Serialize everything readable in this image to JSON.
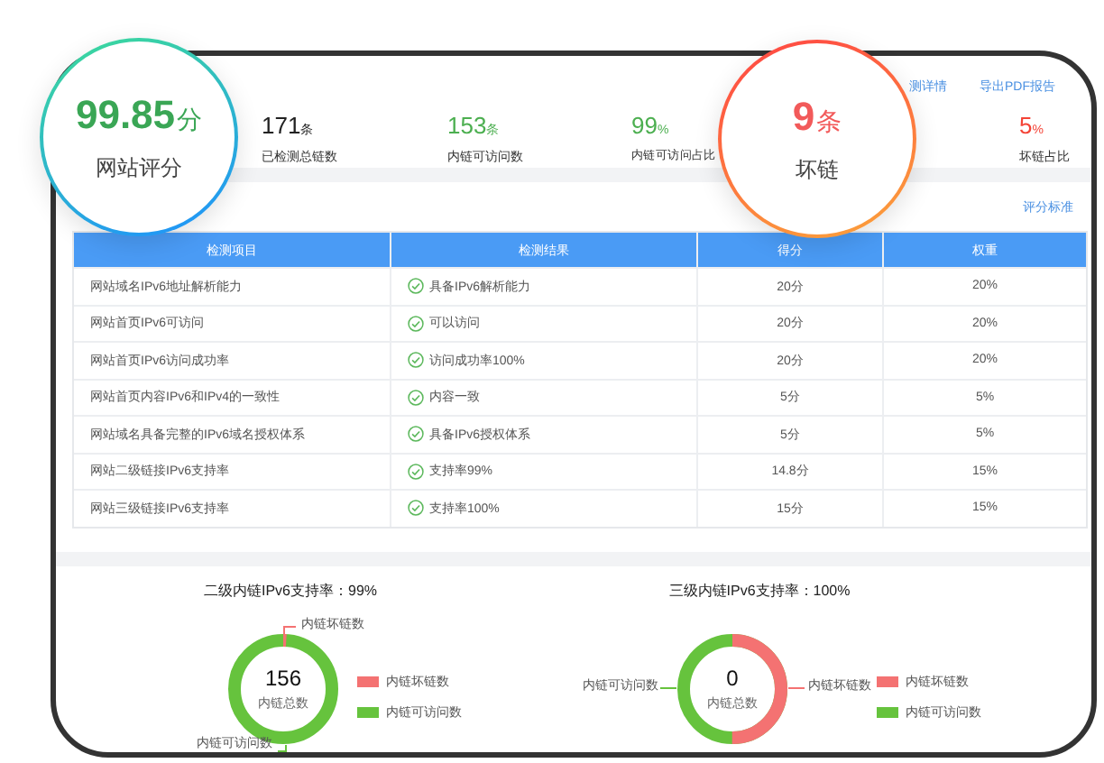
{
  "score_badge": {
    "value": "99.85",
    "unit": "分",
    "label": "网站评分"
  },
  "broken_badge": {
    "value": "9",
    "unit": "条",
    "label": "坏链"
  },
  "links": [
    "测详情",
    "导出PDF报告"
  ],
  "stats": [
    {
      "value": "171",
      "unit": "条",
      "label": "已检测总链数",
      "color": "#222222"
    },
    {
      "value": "153",
      "unit": "条",
      "label": "内链可访问数",
      "color": "#4caf50"
    },
    {
      "value": "99",
      "unit": "%",
      "label": "内链可访问占比",
      "color": "#4caf50"
    },
    {
      "value": "5",
      "unit": "%",
      "label": "坏链占比",
      "color": "#f44336"
    }
  ],
  "criteria_link": "评分标准",
  "table": {
    "columns": [
      "检测项目",
      "检测结果",
      "得分",
      "权重"
    ],
    "rows": [
      {
        "item": "网站域名IPv6地址解析能力",
        "passed": true,
        "result": "具备IPv6解析能力",
        "score": "20分",
        "weight": "20%"
      },
      {
        "item": "网站首页IPv6可访问",
        "passed": true,
        "result": "可以访问",
        "score": "20分",
        "weight": "20%"
      },
      {
        "item": "网站首页IPv6访问成功率",
        "passed": true,
        "result": "访问成功率100%",
        "score": "20分",
        "weight": "20%"
      },
      {
        "item": "网站首页内容IPv6和IPv4的一致性",
        "passed": true,
        "result": "内容一致",
        "score": "5分",
        "weight": "5%"
      },
      {
        "item": "网站域名具备完整的IPv6域名授权体系",
        "passed": true,
        "result": "具备IPv6授权体系",
        "score": "5分",
        "weight": "5%"
      },
      {
        "item": "网站二级链接IPv6支持率",
        "passed": true,
        "result": "支持率99%",
        "score": "14.8分",
        "weight": "15%"
      },
      {
        "item": "网站三级链接IPv6支持率",
        "passed": true,
        "result": "支持率100%",
        "score": "15分",
        "weight": "15%"
      }
    ]
  },
  "donuts": [
    {
      "title": "二级内链IPv6支持率：99%",
      "total": "156",
      "total_label": "内链总数",
      "callouts": [
        {
          "text": "内链坏链数"
        },
        {
          "text": "内链可访问数"
        }
      ],
      "legend": [
        {
          "label": "内链坏链数",
          "color": "#f47272"
        },
        {
          "label": "内链可访问数",
          "color": "#66c33d"
        }
      ]
    },
    {
      "title": "三级内链IPv6支持率：100%",
      "total": "0",
      "total_label": "内链总数",
      "callouts": [
        {
          "text": "内链可访问数"
        },
        {
          "text": "内链坏链数"
        }
      ],
      "legend": [
        {
          "label": "内链坏链数",
          "color": "#f47272"
        },
        {
          "label": "内链可访问数",
          "color": "#66c33d"
        }
      ]
    }
  ]
}
